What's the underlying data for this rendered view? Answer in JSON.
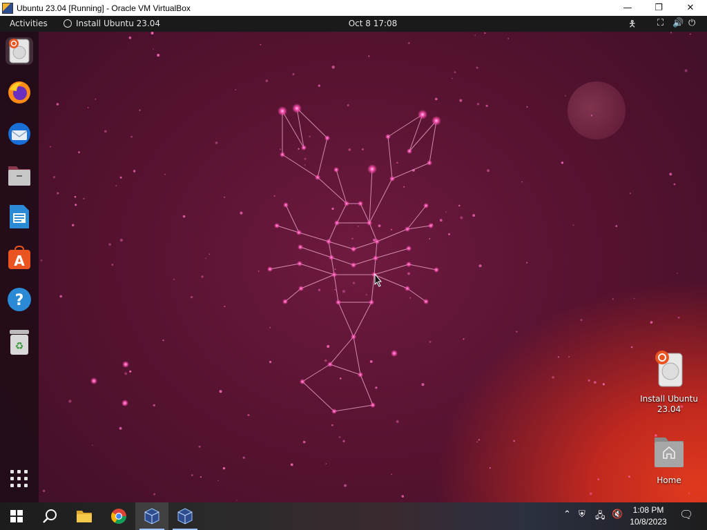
{
  "window": {
    "title": "Ubuntu 23.04 [Running] - Oracle VM VirtualBox",
    "minimize_glyph": "—",
    "restore_glyph": "❐",
    "close_glyph": "✕"
  },
  "topbar": {
    "activities": "Activities",
    "app_name": "Install Ubuntu 23.04",
    "clock": "Oct 8  17:08"
  },
  "dock": {
    "items": [
      {
        "name": "install-ubuntu",
        "icon": "installer-disk-icon"
      },
      {
        "name": "firefox",
        "icon": "firefox-icon"
      },
      {
        "name": "thunderbird",
        "icon": "thunderbird-icon"
      },
      {
        "name": "files",
        "icon": "files-icon"
      },
      {
        "name": "libreoffice-writer",
        "icon": "writer-icon"
      },
      {
        "name": "app-center",
        "icon": "app-store-icon"
      },
      {
        "name": "help",
        "icon": "help-icon"
      },
      {
        "name": "trash",
        "icon": "trash-icon"
      },
      {
        "name": "show-apps",
        "icon": "app-grid-icon"
      }
    ]
  },
  "desktop_icons": {
    "install": "Install Ubuntu\n23.04",
    "home": "Home"
  },
  "taskbar": {
    "time": "1:08 PM",
    "date": "10/8/2023"
  },
  "colors": {
    "wallpaper": "#55122f",
    "accent_orange": "#e95420",
    "star": "#ff5fb0"
  }
}
